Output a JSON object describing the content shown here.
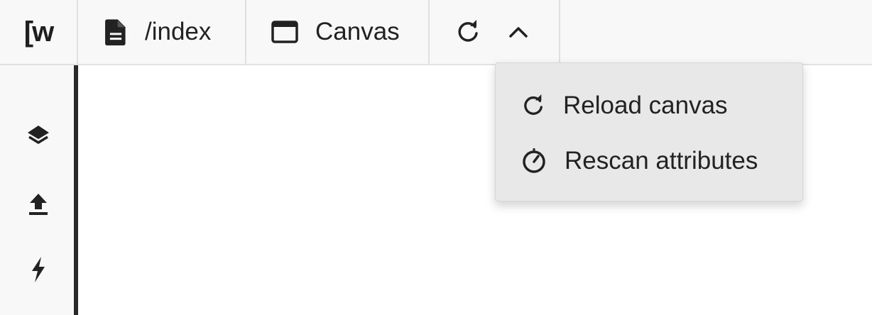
{
  "toolbar": {
    "logo_text": "[w",
    "route_label": "/index",
    "canvas_label": "Canvas"
  },
  "icons": {
    "route": "document-icon",
    "canvas": "window-icon",
    "refresh": "refresh-icon",
    "toggle": "chevron-up-icon"
  },
  "sidebar": {
    "items": [
      "layers-icon",
      "upload-icon",
      "lightning-icon"
    ]
  },
  "dropdown": {
    "items": [
      {
        "label": "Reload canvas",
        "icon": "refresh-icon"
      },
      {
        "label": "Rescan attributes",
        "icon": "timer-icon"
      }
    ]
  },
  "colors": {
    "toolbar_bg": "#f8f8f8",
    "divider": "#e0e0e0",
    "dropdown_bg": "#e8e8e8",
    "text": "#222222",
    "sidebar_border": "#2a2a2a"
  }
}
